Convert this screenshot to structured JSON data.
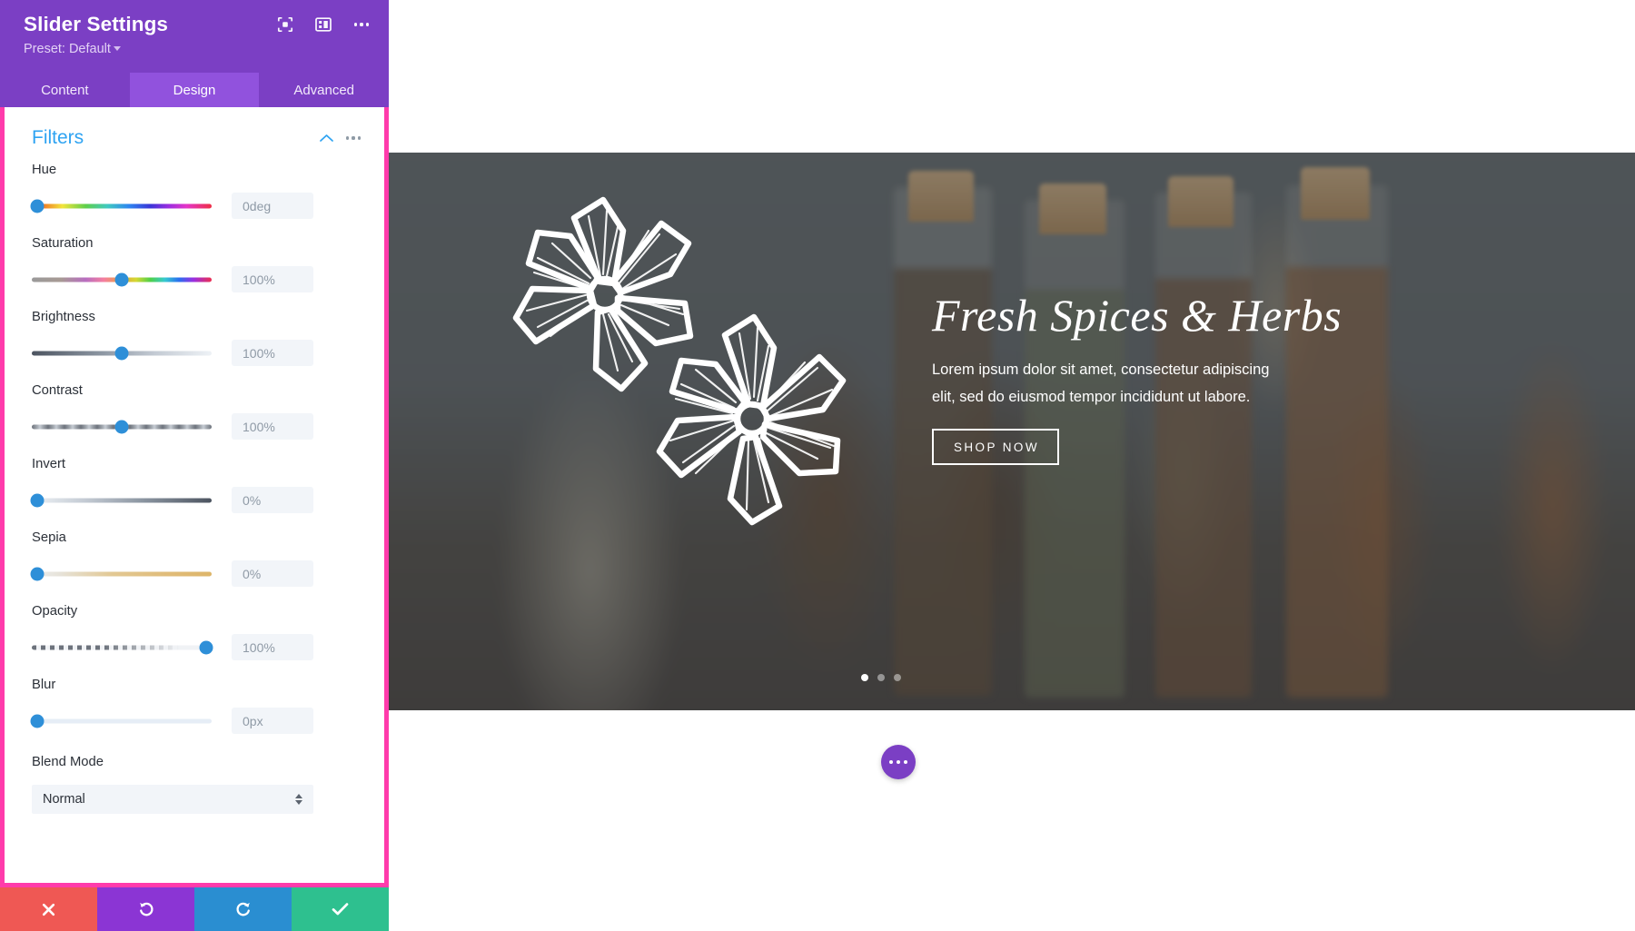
{
  "panel": {
    "title": "Slider Settings",
    "preset_label": "Preset: Default",
    "header_icons": [
      {
        "name": "focus-frame-icon"
      },
      {
        "name": "layout-panel-icon"
      },
      {
        "name": "kebab-menu-icon"
      }
    ],
    "tabs": [
      {
        "label": "Content",
        "active": false
      },
      {
        "label": "Design",
        "active": true
      },
      {
        "label": "Advanced",
        "active": false
      }
    ],
    "section": {
      "title": "Filters",
      "collapse_icon": "chevron-up-icon",
      "menu_icon": "kebab-menu-icon"
    },
    "controls": [
      {
        "label": "Hue",
        "value": "0deg",
        "percent": 3,
        "track": "tr-hue"
      },
      {
        "label": "Saturation",
        "value": "100%",
        "percent": 50,
        "track": "tr-sat"
      },
      {
        "label": "Brightness",
        "value": "100%",
        "percent": 50,
        "track": "tr-bright"
      },
      {
        "label": "Contrast",
        "value": "100%",
        "percent": 50,
        "track": "tr-contrast"
      },
      {
        "label": "Invert",
        "value": "0%",
        "percent": 3,
        "track": "tr-invert"
      },
      {
        "label": "Sepia",
        "value": "0%",
        "percent": 3,
        "track": "tr-sepia"
      },
      {
        "label": "Opacity",
        "value": "100%",
        "percent": 97,
        "track": "tr-opacity"
      },
      {
        "label": "Blur",
        "value": "0px",
        "percent": 3,
        "track": "tr-blur"
      }
    ],
    "blend_mode": {
      "label": "Blend Mode",
      "value": "Normal"
    },
    "footer": [
      {
        "name": "cancel-button",
        "glyph": "✖"
      },
      {
        "name": "undo-button",
        "glyph": "↺"
      },
      {
        "name": "redo-button",
        "glyph": "↻"
      },
      {
        "name": "save-button",
        "glyph": "✔"
      }
    ],
    "accent_pink": "#ff3bab",
    "accent_purple": "#7b3fc4",
    "accent_blue": "#2ea3f2"
  },
  "canvas": {
    "hero": {
      "title": "Fresh Spices & Herbs",
      "subtitle": "Lorem ipsum dolor sit amet, consectetur adipiscing elit, sed do eiusmod tempor incididunt ut labore.",
      "button_label": "SHOP NOW",
      "dots": [
        {
          "active": true
        },
        {
          "active": false
        },
        {
          "active": false
        }
      ]
    },
    "fab": {
      "name": "page-settings-fab"
    }
  }
}
